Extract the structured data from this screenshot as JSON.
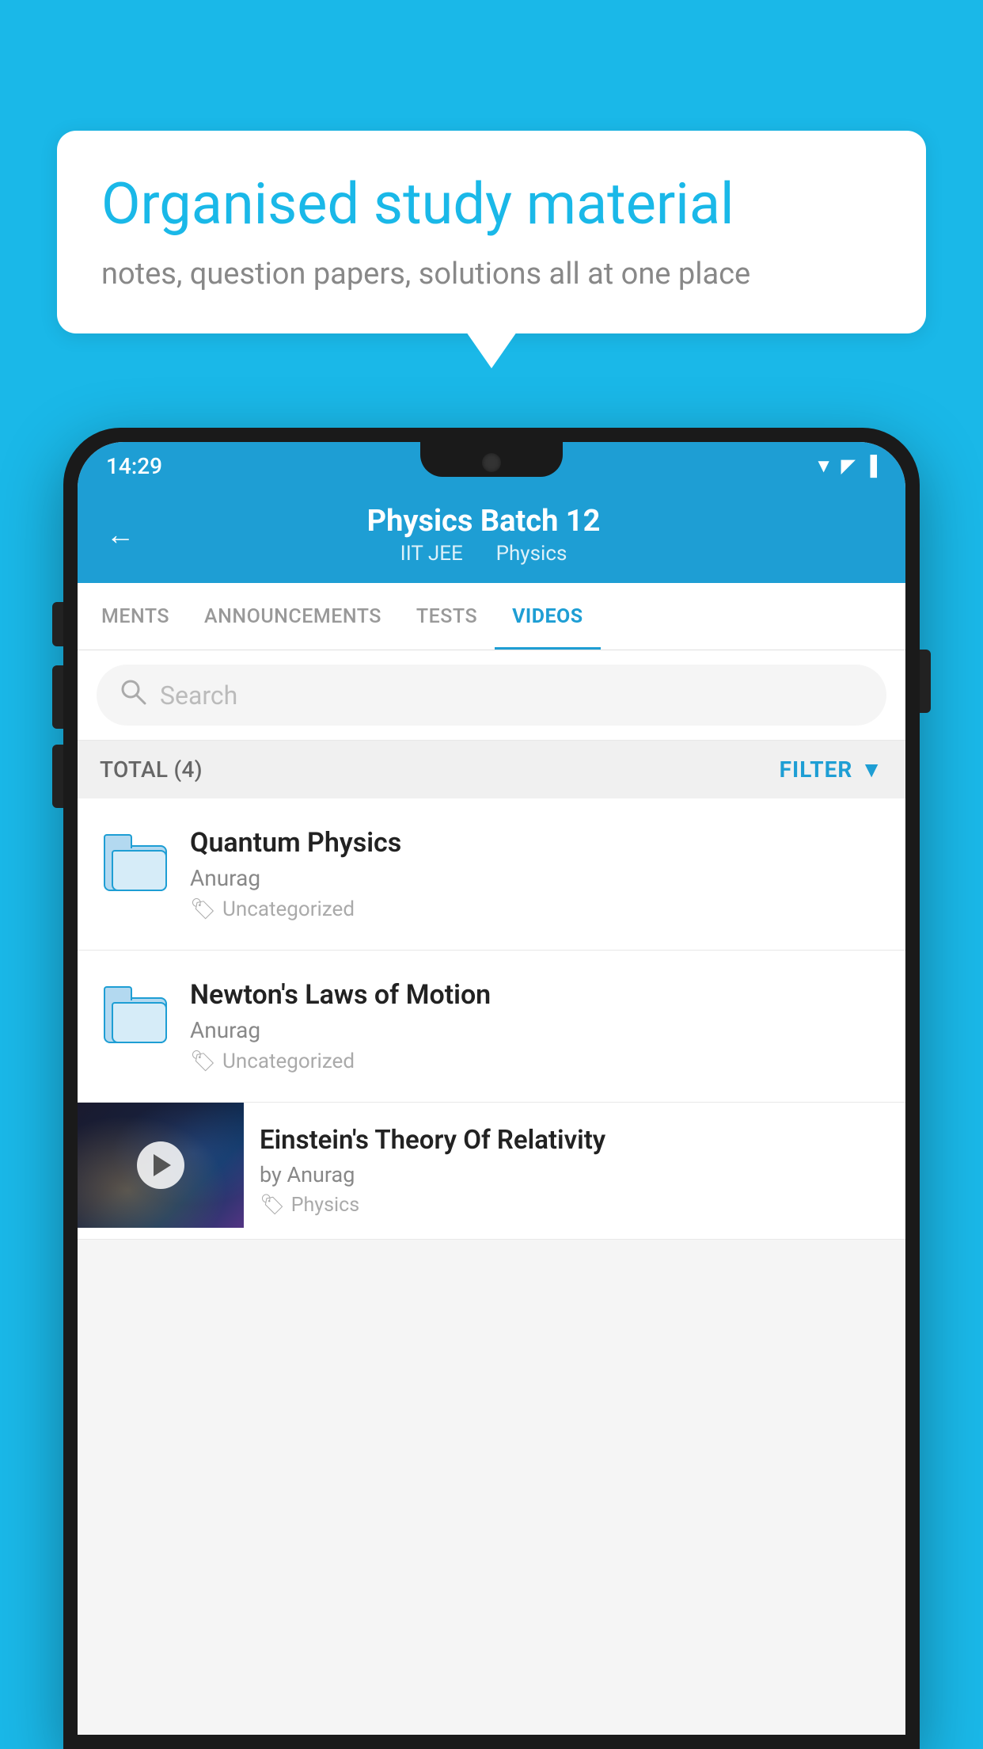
{
  "background_color": "#1ab8e8",
  "bubble": {
    "title": "Organised study material",
    "subtitle": "notes, question papers, solutions all at one place"
  },
  "status_bar": {
    "time": "14:29",
    "wifi_icon": "▲",
    "signal_icon": "▲",
    "battery_icon": "▮"
  },
  "header": {
    "back_label": "←",
    "title": "Physics Batch 12",
    "subtitle_part1": "IIT JEE",
    "subtitle_part2": "Physics"
  },
  "tabs": [
    {
      "label": "MENTS",
      "active": false
    },
    {
      "label": "ANNOUNCEMENTS",
      "active": false
    },
    {
      "label": "TESTS",
      "active": false
    },
    {
      "label": "VIDEOS",
      "active": true
    }
  ],
  "search": {
    "placeholder": "Search"
  },
  "filter_bar": {
    "total_label": "TOTAL (4)",
    "filter_label": "FILTER"
  },
  "list_items": [
    {
      "title": "Quantum Physics",
      "author": "Anurag",
      "tag": "Uncategorized",
      "type": "folder"
    },
    {
      "title": "Newton's Laws of Motion",
      "author": "Anurag",
      "tag": "Uncategorized",
      "type": "folder"
    },
    {
      "title": "Einstein's Theory Of Relativity",
      "author": "by Anurag",
      "tag": "Physics",
      "type": "video"
    }
  ]
}
